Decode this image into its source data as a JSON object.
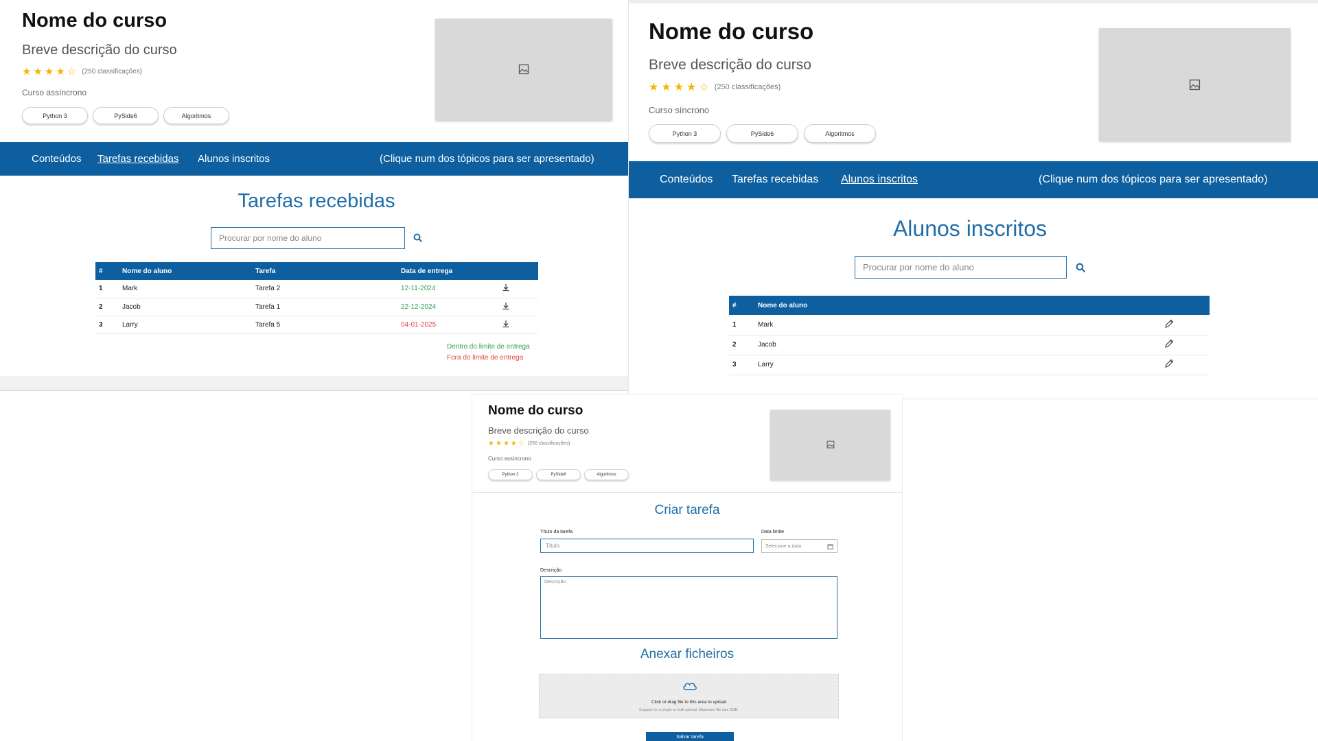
{
  "panel_a": {
    "course": {
      "title": "Nome do curso",
      "description": "Breve descrição do curso",
      "rating": 4,
      "rating_max": 5,
      "ratings_count": "(250 classificações)",
      "type": "Curso assíncrono",
      "tags": [
        "Python 3",
        "PySide6",
        "Algoritmos"
      ]
    },
    "nav": {
      "items": [
        "Conteúdos",
        "Tarefas recebidas",
        "Alunos inscritos"
      ],
      "active_index": 1,
      "hint": "(Clique num dos tópicos para ser apresentado)"
    },
    "section_title": "Tarefas recebidas",
    "search": {
      "placeholder": "Procurar por nome do aluno"
    },
    "table": {
      "headers": [
        "#",
        "Nome do aluno",
        "Tarefa",
        "Data de entrega",
        ""
      ],
      "rows": [
        {
          "num": "1",
          "name": "Mark",
          "task": "Tarefa 2",
          "date": "12-11-2024",
          "status": "on-time"
        },
        {
          "num": "2",
          "name": "Jacob",
          "task": "Tarefa 1",
          "date": "22-12-2024",
          "status": "on-time"
        },
        {
          "num": "3",
          "name": "Larry",
          "task": "Tarefa 5",
          "date": "04-01-2025",
          "status": "late"
        }
      ]
    },
    "legend": {
      "on_time": "Dentro do limite de entrega",
      "late": "Fora do limite de entrega"
    }
  },
  "panel_b": {
    "course": {
      "title": "Nome do curso",
      "description": "Breve descrição do curso",
      "rating": 4,
      "rating_max": 5,
      "ratings_count": "(250 classificações)",
      "type": "Curso síncrono",
      "tags": [
        "Python 3",
        "PySide6",
        "Algoritmos"
      ]
    },
    "nav": {
      "items": [
        "Conteúdos",
        "Tarefas recebidas",
        "Alunos inscritos"
      ],
      "active_index": 2,
      "hint": "(Clique num dos tópicos para ser apresentado)"
    },
    "section_title": "Alunos inscritos",
    "search": {
      "placeholder": "Procurar por nome do aluno"
    },
    "table": {
      "headers": [
        "#",
        "Nome do aluno",
        ""
      ],
      "rows": [
        {
          "num": "1",
          "name": "Mark"
        },
        {
          "num": "2",
          "name": "Jacob"
        },
        {
          "num": "3",
          "name": "Larry"
        }
      ]
    }
  },
  "panel_c": {
    "course": {
      "title": "Nome do curso",
      "description": "Breve descrição do curso",
      "rating": 4,
      "rating_max": 5,
      "ratings_count": "(250 classificações)",
      "type": "Curso assíncrono",
      "tags": [
        "Python 3",
        "PySide6",
        "Algoritmos"
      ]
    },
    "form_title": "Criar tarefa",
    "fields": {
      "title_label": "Título da tarefa",
      "title_placeholder": "Título",
      "date_label": "Data limite",
      "date_placeholder": "Selecione a data",
      "description_label": "Descrição",
      "description_placeholder": "Descrição"
    },
    "attach_title": "Anexar ficheiros",
    "upload": {
      "text": "Click or drag file to this area to upload",
      "hint": "Support for a single or bulk upload. Maximum file size 2MB."
    },
    "submit_label": "Salvar tarefa"
  },
  "colors": {
    "primary": "#0d5fa0",
    "title_blue": "#1f6ea8",
    "star": "#f5b400",
    "on_time": "#2ea44f",
    "late": "#e0453a"
  },
  "icons": [
    "image-placeholder-icon",
    "search-icon",
    "download-icon",
    "edit-pencil-icon",
    "calendar-icon",
    "cloud-upload-icon",
    "star-icon"
  ]
}
